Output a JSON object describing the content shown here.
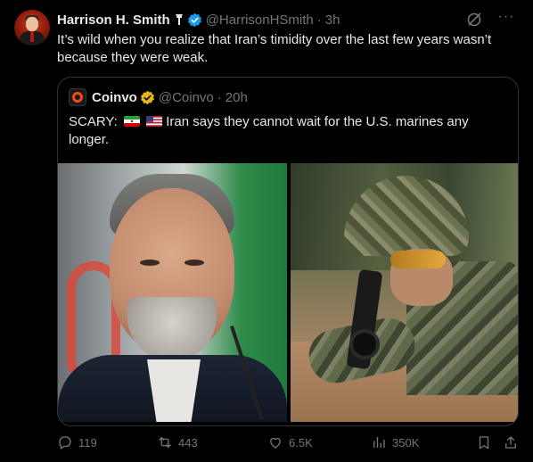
{
  "tweet": {
    "author_name": "Harrison H. Smith",
    "author_handle": "@HarrisonHSmith",
    "separator": "·",
    "time": "3h",
    "more_label": "···",
    "text": "It’s wild when you realize that Iran’s timidity over the last few years wasn’t because they were weak.",
    "colors": {
      "verified": "#1d9bf0",
      "muted": "#71767b",
      "text": "#e7e9ea",
      "background": "#000000"
    }
  },
  "quote": {
    "author_name": "Coinvo",
    "author_handle": "@Coinvo",
    "separator": "·",
    "time": "20h",
    "text_prefix": "SCARY:",
    "text_body": "Iran says they cannot wait for the U.S. marines any longer.",
    "flags": [
      "iran-flag-icon",
      "us-flag-icon"
    ],
    "badge_color": "#e2b719"
  },
  "actions": {
    "replies": "119",
    "reposts": "443",
    "likes": "6.5K",
    "views": "350K"
  }
}
